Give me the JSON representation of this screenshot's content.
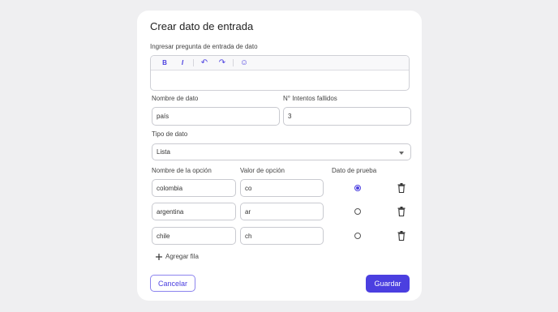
{
  "dialog": {
    "title": "Crear dato de entrada"
  },
  "question": {
    "label": "Ingresar pregunta de entrada de dato",
    "value": ""
  },
  "toolbar": {
    "bold": "B",
    "italic": "I",
    "undo": "↶",
    "redo": "↷",
    "emoji": "☺"
  },
  "name_field": {
    "label": "Nombre de dato",
    "value": "país"
  },
  "attempts_field": {
    "label": "N° Intentos fallidos",
    "value": "3"
  },
  "type_field": {
    "label": "Tipo de dato",
    "value": "Lista"
  },
  "options": {
    "headers": {
      "name": "Nombre de la opción",
      "value": "Valor de opción",
      "test": "Dato de prueba"
    },
    "rows": [
      {
        "name": "colombia",
        "value": "co",
        "selected": true
      },
      {
        "name": "argentina",
        "value": "ar",
        "selected": false
      },
      {
        "name": "chile",
        "value": "ch",
        "selected": false
      }
    ],
    "add_label": "Agregar fila"
  },
  "buttons": {
    "cancel": "Cancelar",
    "save": "Guardar"
  },
  "colors": {
    "accent": "#4b3fe0",
    "border": "#c9cad0",
    "background": "#efeff1"
  }
}
